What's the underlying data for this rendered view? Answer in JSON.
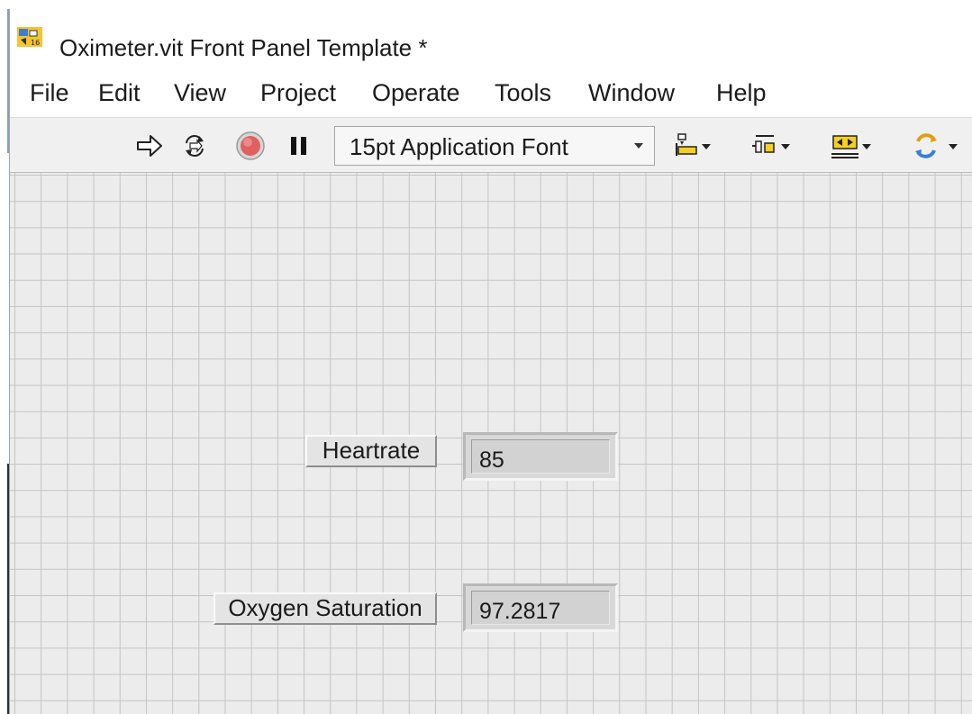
{
  "window": {
    "title": "Oximeter.vit Front Panel Template *"
  },
  "menu": {
    "items": [
      "File",
      "Edit",
      "View",
      "Project",
      "Operate",
      "Tools",
      "Window",
      "Help"
    ]
  },
  "toolbar": {
    "buttons": [
      "run-arrow-icon",
      "run-continuously-icon",
      "abort-icon",
      "pause-icon"
    ],
    "font_select": {
      "value": "15pt Application Font"
    },
    "align_buttons": [
      "align-objects-icon",
      "distribute-objects-icon",
      "resize-objects-icon",
      "reorder-icon"
    ]
  },
  "panel": {
    "heartrate": {
      "label": "Heartrate",
      "value": "85"
    },
    "oxygen": {
      "label": "Oxygen Saturation",
      "value": "97.2817"
    }
  },
  "colors": {
    "canvas": "#ececec",
    "grid": "#c4c4c4",
    "abort_red": "#e06060",
    "window_bg": "#f0f0f0"
  }
}
